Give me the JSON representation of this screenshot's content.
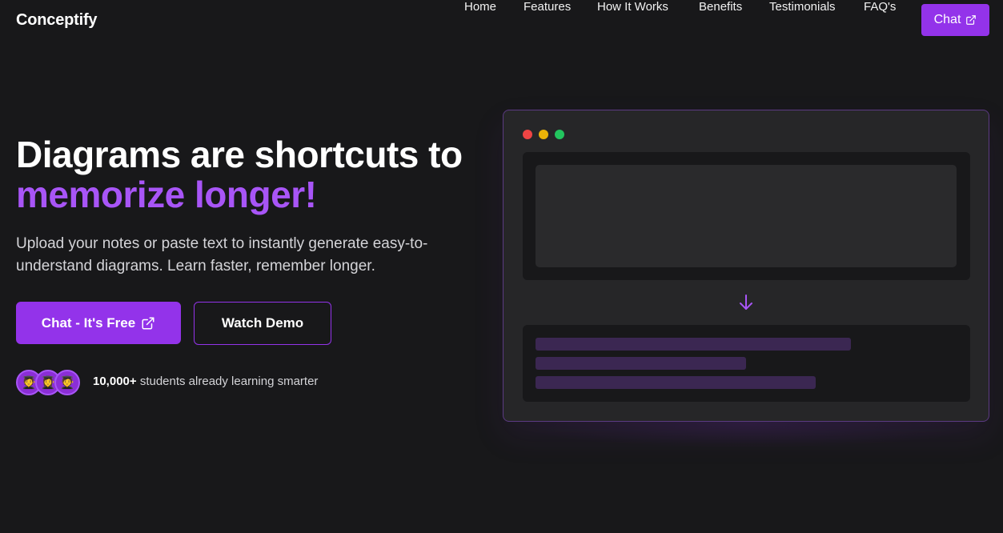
{
  "brand": "Conceptify",
  "nav": {
    "links": [
      "Home",
      "Features",
      "How It Works",
      "Benefits",
      "Testimonials",
      "FAQ's"
    ],
    "chat_label": "Chat",
    "chat_icon": "external-link-icon"
  },
  "hero": {
    "title_line1": "Diagrams are shortcuts to",
    "title_line2": "memorize longer!",
    "subtitle": "Upload your notes or paste text to instantly generate easy-to-understand diagrams. Learn faster, remember longer.",
    "primary_button": "Chat - It's Free",
    "secondary_button": "Watch Demo",
    "social_proof_count": "10,000+",
    "social_proof_text": "students already learning smarter",
    "avatars": [
      "🧑‍🎓",
      "👩‍🎓",
      "🧑‍🎓"
    ]
  },
  "colors": {
    "background": "#18181a",
    "accent": "#9333ea",
    "accent_text": "#a855f7",
    "window_dot_red": "#ef4444",
    "window_dot_yellow": "#eab308",
    "window_dot_green": "#22c55e"
  },
  "mock_window": {
    "icon": "arrow-down-icon"
  }
}
